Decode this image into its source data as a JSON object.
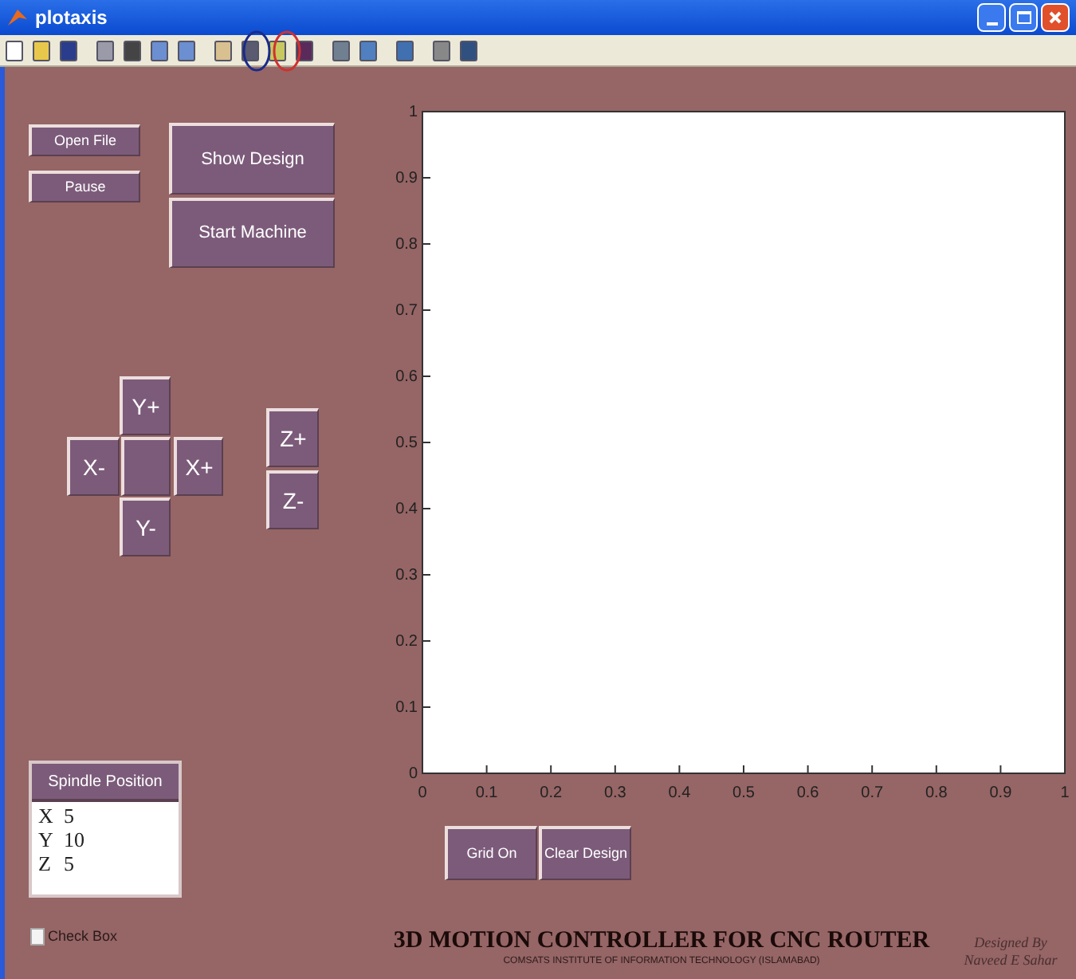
{
  "window": {
    "title": "plotaxis"
  },
  "file_buttons": [
    "Open File",
    "Pause"
  ],
  "action_buttons": [
    "Show Design",
    "Start Machine"
  ],
  "jog_buttons": {
    "y_plus": "Y+",
    "x_minus": "X-",
    "x_plus": "X+",
    "y_minus": "Y-"
  },
  "z_buttons": [
    "Z+",
    "Z-"
  ],
  "chart_data": {
    "type": "line",
    "xlim": [
      0,
      1
    ],
    "ylim": [
      0,
      1
    ],
    "xticks": [
      0,
      0.1,
      0.2,
      0.3,
      0.4,
      0.5,
      0.6,
      0.7,
      0.8,
      0.9,
      1
    ],
    "yticks": [
      0,
      0.1,
      0.2,
      0.3,
      0.4,
      0.5,
      0.6,
      0.7,
      0.8,
      0.9,
      1
    ]
  },
  "plot_buttons": [
    "Grid On",
    "Clear Design"
  ],
  "spindle_position": {
    "title": "Spindle Position",
    "rows": [
      {
        "axis": "X",
        "value": "5"
      },
      {
        "axis": "Y",
        "value": "10"
      },
      {
        "axis": "Z",
        "value": "5"
      }
    ]
  },
  "checkbox": {
    "label": "Check Box",
    "checked": false
  },
  "footer": {
    "title": "3D MOTION CONTROLLER FOR CNC ROUTER",
    "subtitle": "COMSATS INSTITUTE OF INFORMATION TECHNOLOGY (ISLAMABAD)",
    "credit": "Designed By",
    "author": "Naveed E Sahar"
  }
}
